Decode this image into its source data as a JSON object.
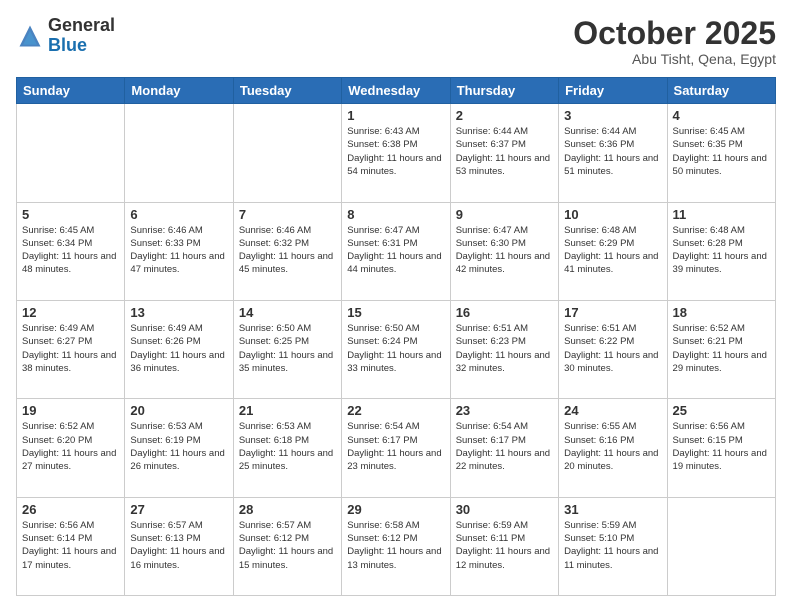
{
  "header": {
    "logo_line1": "General",
    "logo_line2": "Blue",
    "month": "October 2025",
    "location": "Abu Tisht, Qena, Egypt"
  },
  "weekdays": [
    "Sunday",
    "Monday",
    "Tuesday",
    "Wednesday",
    "Thursday",
    "Friday",
    "Saturday"
  ],
  "weeks": [
    [
      {
        "day": "",
        "sunrise": "",
        "sunset": "",
        "daylight": "",
        "empty": true
      },
      {
        "day": "",
        "sunrise": "",
        "sunset": "",
        "daylight": "",
        "empty": true
      },
      {
        "day": "",
        "sunrise": "",
        "sunset": "",
        "daylight": "",
        "empty": true
      },
      {
        "day": "1",
        "sunrise": "Sunrise: 6:43 AM",
        "sunset": "Sunset: 6:38 PM",
        "daylight": "Daylight: 11 hours and 54 minutes."
      },
      {
        "day": "2",
        "sunrise": "Sunrise: 6:44 AM",
        "sunset": "Sunset: 6:37 PM",
        "daylight": "Daylight: 11 hours and 53 minutes."
      },
      {
        "day": "3",
        "sunrise": "Sunrise: 6:44 AM",
        "sunset": "Sunset: 6:36 PM",
        "daylight": "Daylight: 11 hours and 51 minutes."
      },
      {
        "day": "4",
        "sunrise": "Sunrise: 6:45 AM",
        "sunset": "Sunset: 6:35 PM",
        "daylight": "Daylight: 11 hours and 50 minutes."
      }
    ],
    [
      {
        "day": "5",
        "sunrise": "Sunrise: 6:45 AM",
        "sunset": "Sunset: 6:34 PM",
        "daylight": "Daylight: 11 hours and 48 minutes."
      },
      {
        "day": "6",
        "sunrise": "Sunrise: 6:46 AM",
        "sunset": "Sunset: 6:33 PM",
        "daylight": "Daylight: 11 hours and 47 minutes."
      },
      {
        "day": "7",
        "sunrise": "Sunrise: 6:46 AM",
        "sunset": "Sunset: 6:32 PM",
        "daylight": "Daylight: 11 hours and 45 minutes."
      },
      {
        "day": "8",
        "sunrise": "Sunrise: 6:47 AM",
        "sunset": "Sunset: 6:31 PM",
        "daylight": "Daylight: 11 hours and 44 minutes."
      },
      {
        "day": "9",
        "sunrise": "Sunrise: 6:47 AM",
        "sunset": "Sunset: 6:30 PM",
        "daylight": "Daylight: 11 hours and 42 minutes."
      },
      {
        "day": "10",
        "sunrise": "Sunrise: 6:48 AM",
        "sunset": "Sunset: 6:29 PM",
        "daylight": "Daylight: 11 hours and 41 minutes."
      },
      {
        "day": "11",
        "sunrise": "Sunrise: 6:48 AM",
        "sunset": "Sunset: 6:28 PM",
        "daylight": "Daylight: 11 hours and 39 minutes."
      }
    ],
    [
      {
        "day": "12",
        "sunrise": "Sunrise: 6:49 AM",
        "sunset": "Sunset: 6:27 PM",
        "daylight": "Daylight: 11 hours and 38 minutes."
      },
      {
        "day": "13",
        "sunrise": "Sunrise: 6:49 AM",
        "sunset": "Sunset: 6:26 PM",
        "daylight": "Daylight: 11 hours and 36 minutes."
      },
      {
        "day": "14",
        "sunrise": "Sunrise: 6:50 AM",
        "sunset": "Sunset: 6:25 PM",
        "daylight": "Daylight: 11 hours and 35 minutes."
      },
      {
        "day": "15",
        "sunrise": "Sunrise: 6:50 AM",
        "sunset": "Sunset: 6:24 PM",
        "daylight": "Daylight: 11 hours and 33 minutes."
      },
      {
        "day": "16",
        "sunrise": "Sunrise: 6:51 AM",
        "sunset": "Sunset: 6:23 PM",
        "daylight": "Daylight: 11 hours and 32 minutes."
      },
      {
        "day": "17",
        "sunrise": "Sunrise: 6:51 AM",
        "sunset": "Sunset: 6:22 PM",
        "daylight": "Daylight: 11 hours and 30 minutes."
      },
      {
        "day": "18",
        "sunrise": "Sunrise: 6:52 AM",
        "sunset": "Sunset: 6:21 PM",
        "daylight": "Daylight: 11 hours and 29 minutes."
      }
    ],
    [
      {
        "day": "19",
        "sunrise": "Sunrise: 6:52 AM",
        "sunset": "Sunset: 6:20 PM",
        "daylight": "Daylight: 11 hours and 27 minutes."
      },
      {
        "day": "20",
        "sunrise": "Sunrise: 6:53 AM",
        "sunset": "Sunset: 6:19 PM",
        "daylight": "Daylight: 11 hours and 26 minutes."
      },
      {
        "day": "21",
        "sunrise": "Sunrise: 6:53 AM",
        "sunset": "Sunset: 6:18 PM",
        "daylight": "Daylight: 11 hours and 25 minutes."
      },
      {
        "day": "22",
        "sunrise": "Sunrise: 6:54 AM",
        "sunset": "Sunset: 6:17 PM",
        "daylight": "Daylight: 11 hours and 23 minutes."
      },
      {
        "day": "23",
        "sunrise": "Sunrise: 6:54 AM",
        "sunset": "Sunset: 6:17 PM",
        "daylight": "Daylight: 11 hours and 22 minutes."
      },
      {
        "day": "24",
        "sunrise": "Sunrise: 6:55 AM",
        "sunset": "Sunset: 6:16 PM",
        "daylight": "Daylight: 11 hours and 20 minutes."
      },
      {
        "day": "25",
        "sunrise": "Sunrise: 6:56 AM",
        "sunset": "Sunset: 6:15 PM",
        "daylight": "Daylight: 11 hours and 19 minutes."
      }
    ],
    [
      {
        "day": "26",
        "sunrise": "Sunrise: 6:56 AM",
        "sunset": "Sunset: 6:14 PM",
        "daylight": "Daylight: 11 hours and 17 minutes."
      },
      {
        "day": "27",
        "sunrise": "Sunrise: 6:57 AM",
        "sunset": "Sunset: 6:13 PM",
        "daylight": "Daylight: 11 hours and 16 minutes."
      },
      {
        "day": "28",
        "sunrise": "Sunrise: 6:57 AM",
        "sunset": "Sunset: 6:12 PM",
        "daylight": "Daylight: 11 hours and 15 minutes."
      },
      {
        "day": "29",
        "sunrise": "Sunrise: 6:58 AM",
        "sunset": "Sunset: 6:12 PM",
        "daylight": "Daylight: 11 hours and 13 minutes."
      },
      {
        "day": "30",
        "sunrise": "Sunrise: 6:59 AM",
        "sunset": "Sunset: 6:11 PM",
        "daylight": "Daylight: 11 hours and 12 minutes."
      },
      {
        "day": "31",
        "sunrise": "Sunrise: 5:59 AM",
        "sunset": "Sunset: 5:10 PM",
        "daylight": "Daylight: 11 hours and 11 minutes."
      },
      {
        "day": "",
        "sunrise": "",
        "sunset": "",
        "daylight": "",
        "empty": true
      }
    ]
  ]
}
